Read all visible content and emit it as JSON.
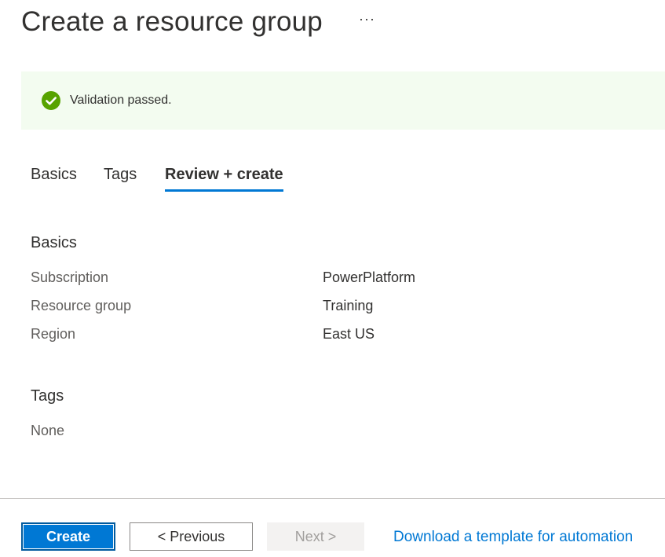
{
  "header": {
    "title": "Create a resource group",
    "more_label": "···"
  },
  "banner": {
    "icon": "check-circle-icon",
    "message": "Validation passed.",
    "color": "#57a300",
    "background": "#f3fcf0"
  },
  "tabs": [
    {
      "label": "Basics",
      "active": false
    },
    {
      "label": "Tags",
      "active": false
    },
    {
      "label": "Review + create",
      "active": true
    }
  ],
  "review": {
    "basics": {
      "heading": "Basics",
      "rows": [
        {
          "label": "Subscription",
          "value": "PowerPlatform"
        },
        {
          "label": "Resource group",
          "value": "Training"
        },
        {
          "label": "Region",
          "value": "East US"
        }
      ]
    },
    "tags": {
      "heading": "Tags",
      "value": "None"
    }
  },
  "footer": {
    "create_label": "Create",
    "previous_label": "< Previous",
    "next_label": "Next >",
    "next_disabled": true,
    "download_link": "Download a template for automation"
  },
  "colors": {
    "accent": "#0078d4",
    "success": "#57a300"
  }
}
